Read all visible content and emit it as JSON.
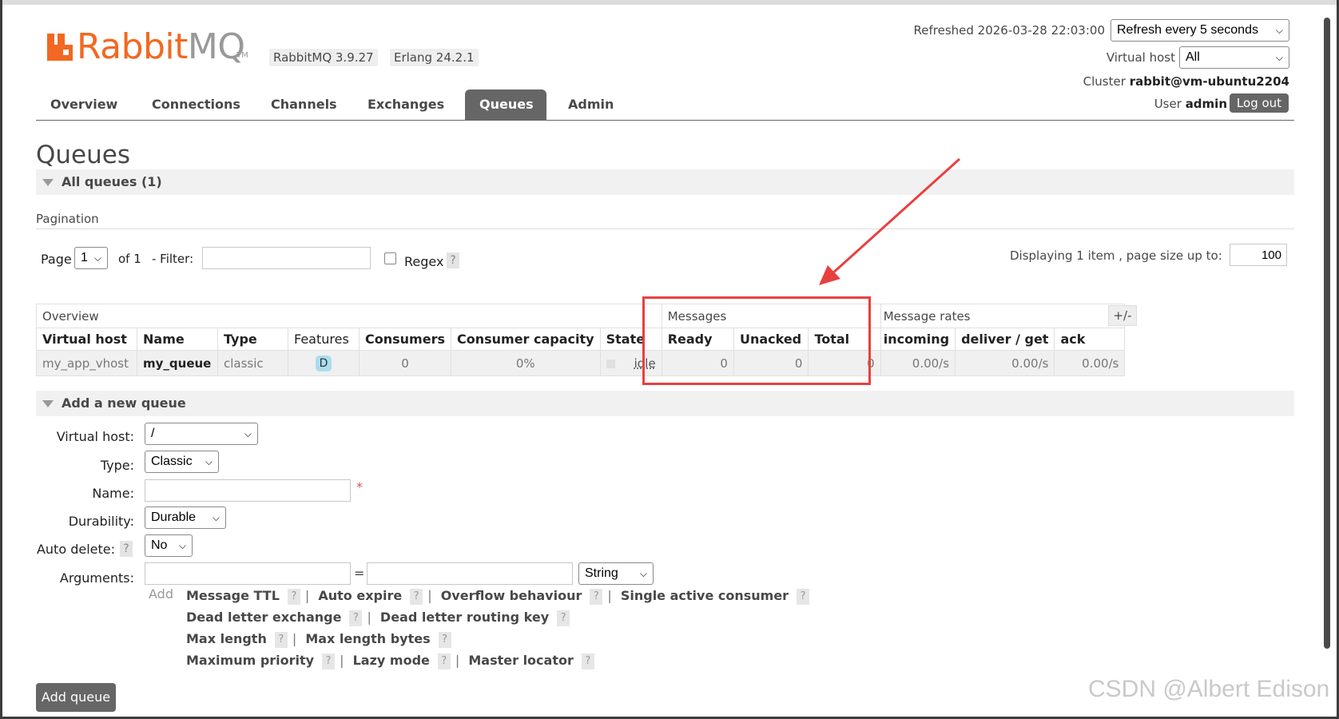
{
  "header": {
    "logo_rabbit": "Rabbit",
    "logo_mq": "MQ",
    "logo_tm": "TM",
    "version_rabbit": "RabbitMQ 3.9.27",
    "version_erlang": "Erlang 24.2.1",
    "refreshed_label": "Refreshed 2026-03-28 22:03:00",
    "refresh_select": "Refresh every 5 seconds",
    "vhost_label": "Virtual host",
    "vhost_select": "All",
    "cluster_label": "Cluster",
    "cluster_value": "rabbit@vm-ubuntu2204",
    "user_label": "User",
    "user_value": "admin",
    "logout": "Log out"
  },
  "nav": [
    "Overview",
    "Connections",
    "Channels",
    "Exchanges",
    "Queues",
    "Admin"
  ],
  "nav_active": "Queues",
  "page_title": "Queues",
  "all_queues": "All queues (1)",
  "pagination": {
    "title": "Pagination",
    "page_label": "Page",
    "page_value": "1",
    "of_label": "of 1",
    "filter_label": "- Filter:",
    "filter_value": "",
    "regex_label": "Regex",
    "help": "?",
    "displaying": "Displaying 1 item , page size up to:",
    "page_size": "100"
  },
  "table": {
    "groups": [
      "Overview",
      "Messages",
      "Message rates"
    ],
    "plus_minus": "+/-",
    "headers": [
      "Virtual host",
      "Name",
      "Type",
      "Features",
      "Consumers",
      "Consumer capacity",
      "State",
      "Ready",
      "Unacked",
      "Total",
      "incoming",
      "deliver / get",
      "ack"
    ],
    "row": {
      "vhost": "my_app_vhost",
      "name": "my_queue",
      "type": "classic",
      "feature": "D",
      "consumers": "0",
      "capacity": "0%",
      "state": "idle",
      "ready": "0",
      "unacked": "0",
      "total": "0",
      "incoming": "0.00/s",
      "deliver_get": "0.00/s",
      "ack": "0.00/s"
    }
  },
  "add_queue": {
    "section_label": "Add a new queue",
    "vhost_label": "Virtual host:",
    "vhost_value": "/",
    "type_label": "Type:",
    "type_value": "Classic",
    "name_label": "Name:",
    "name_value": "",
    "required_mark": "*",
    "durability_label": "Durability:",
    "durability_value": "Durable",
    "autodelete_label": "Auto delete:",
    "autodelete_value": "No",
    "arguments_label": "Arguments:",
    "equals": "=",
    "arg_type": "String",
    "add_label": "Add",
    "arg_rows": [
      [
        "Message TTL",
        "Auto expire",
        "Overflow behaviour",
        "Single active consumer"
      ],
      [
        "Dead letter exchange",
        "Dead letter routing key"
      ],
      [
        "Max length",
        "Max length bytes"
      ],
      [
        "Maximum priority",
        "Lazy mode",
        "Master locator"
      ]
    ],
    "submit": "Add queue"
  },
  "watermark": "CSDN @Albert Edison",
  "colors": {
    "brand_orange": "#f26822",
    "nav_active_bg": "#666666",
    "highlight_red": "#e8403f",
    "feature_badge": "#aaddee"
  }
}
